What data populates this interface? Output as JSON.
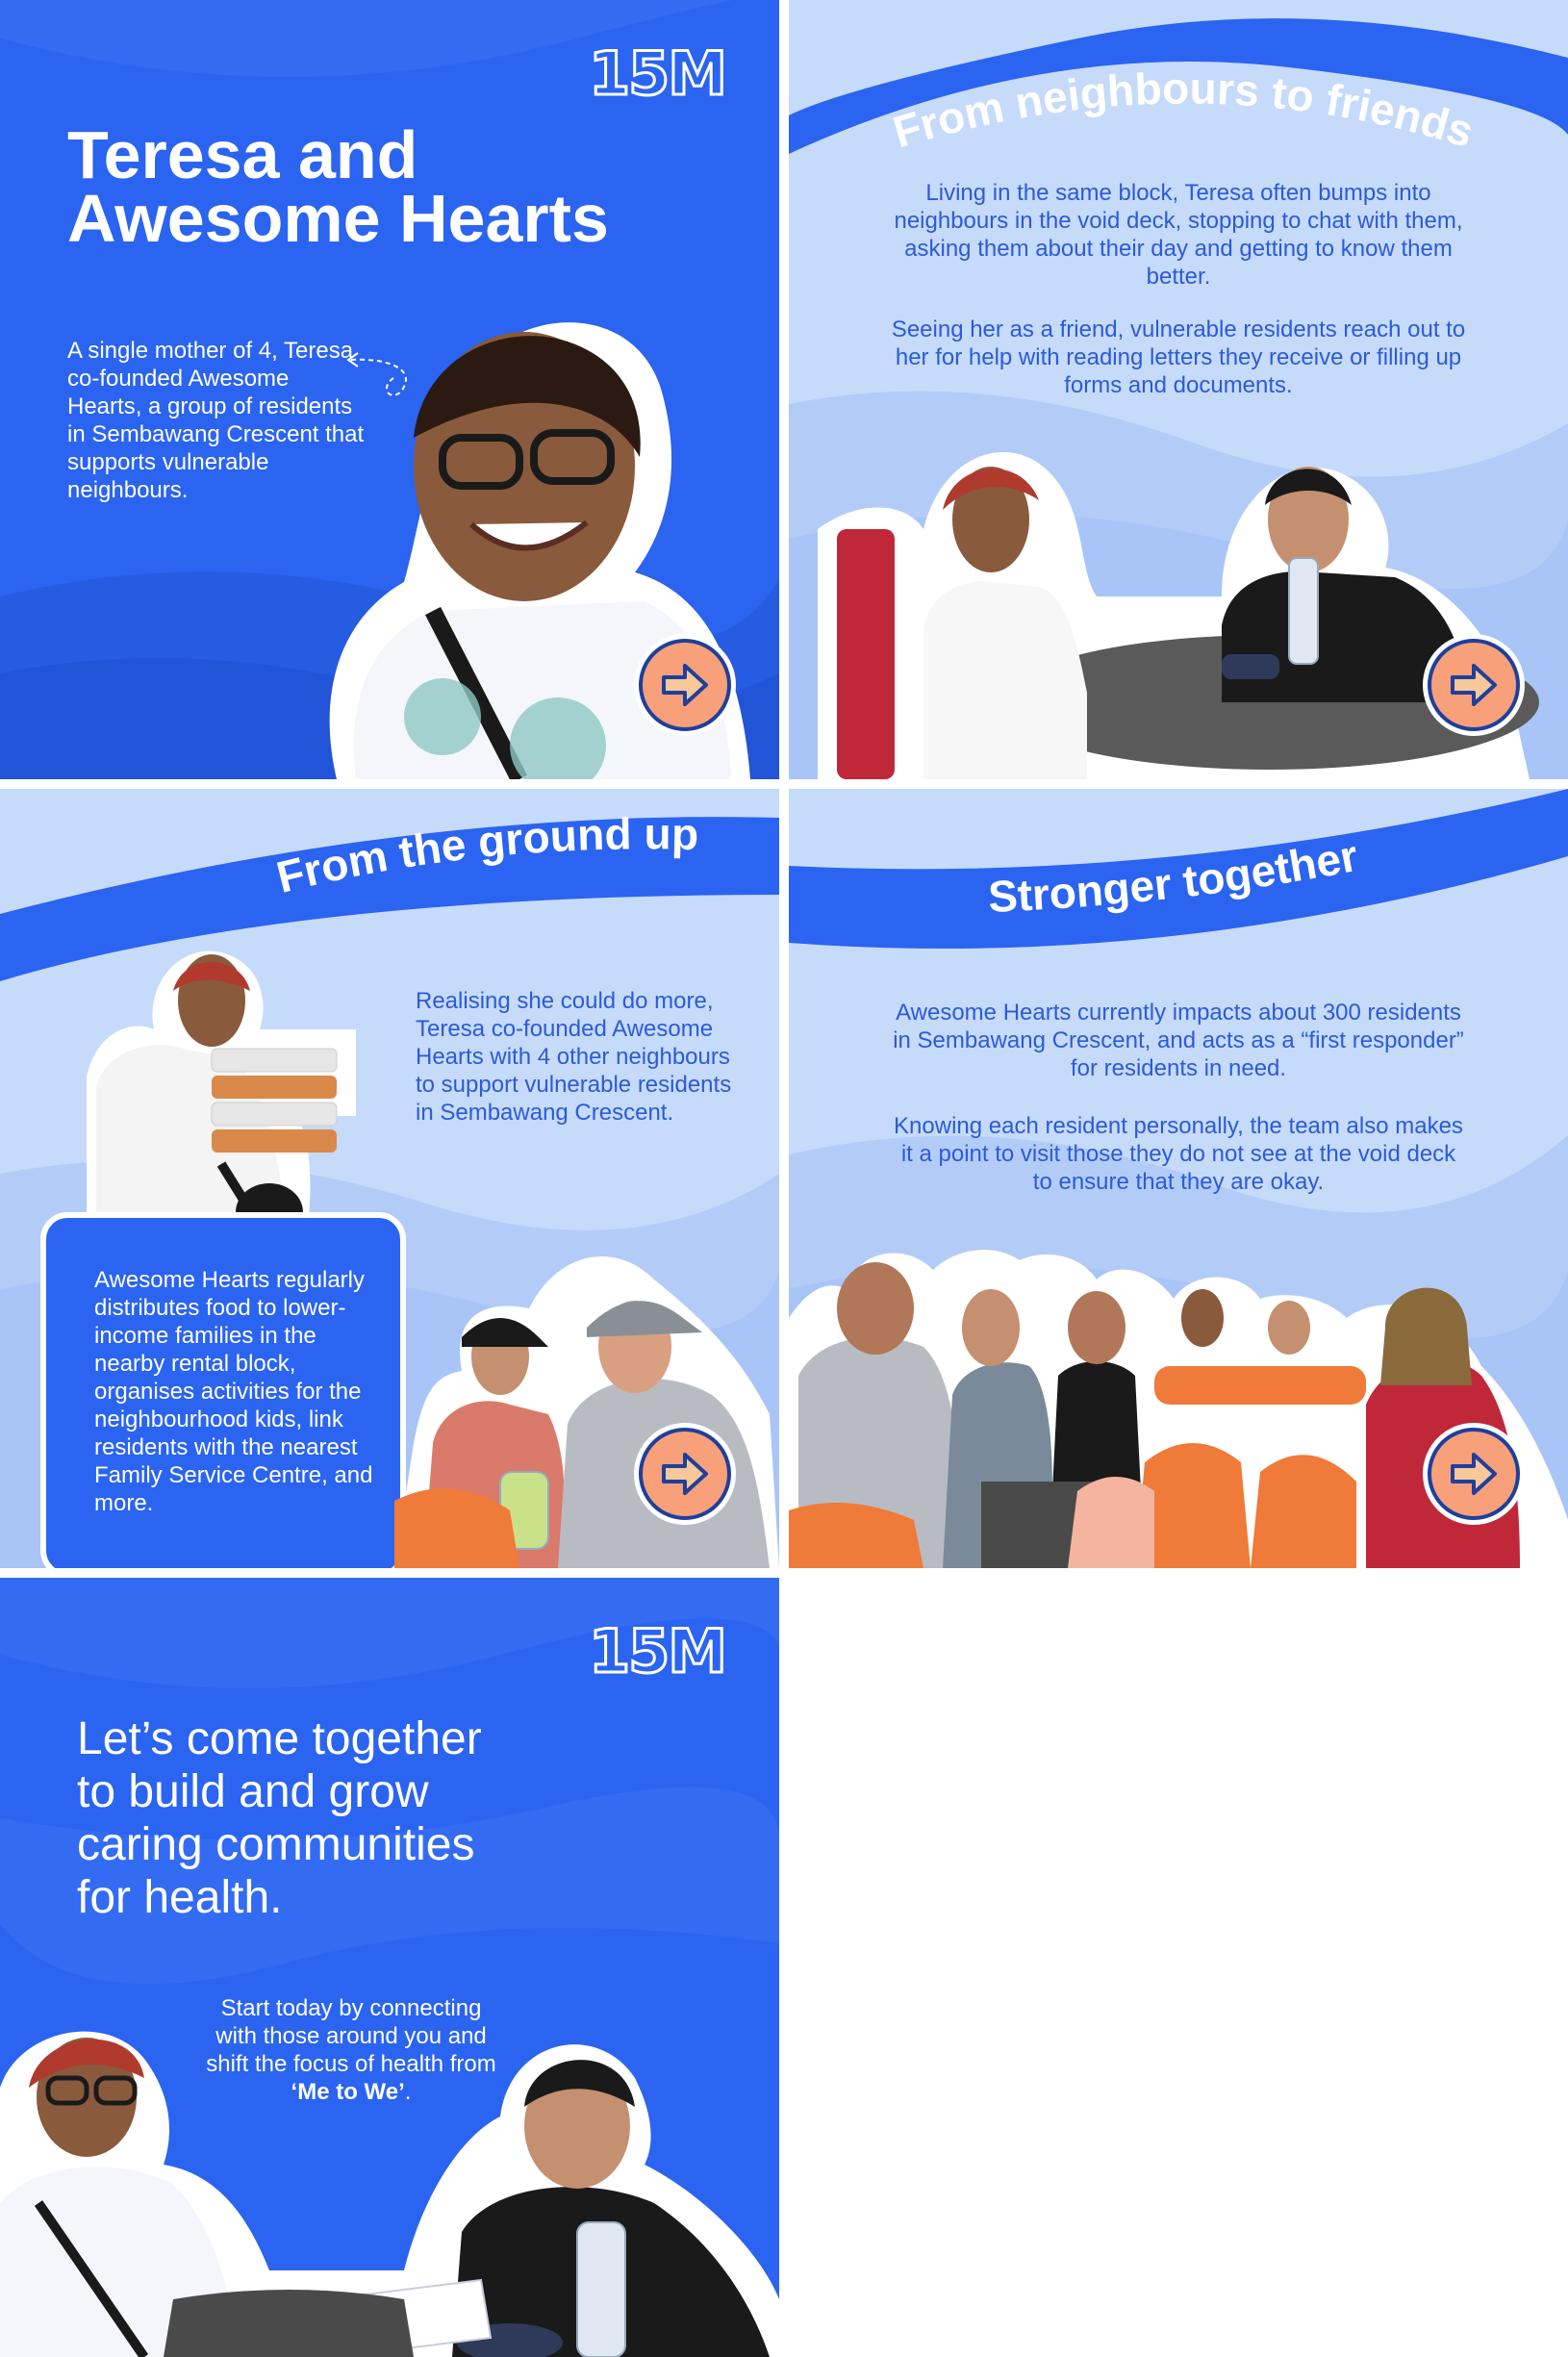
{
  "brand": {
    "logo_text": "15M",
    "primary_blue": "#2a64f0",
    "light_blue": "#c6dafa",
    "accent_orange": "#f7a07a",
    "text_blue": "#2b5bd9"
  },
  "slide1": {
    "title_line1": "Teresa and",
    "title_line2": "Awesome Hearts",
    "body": "A single mother of 4, Teresa co-founded Awesome Hearts, a group of residents in Sembawang Crescent that supports vulnerable neighbours.",
    "next_icon": "arrow-right-icon"
  },
  "slide2": {
    "heading": "From neighbours to friends",
    "para1": "Living in the same block, Teresa often bumps into neighbours in the void deck, stopping to chat with them, asking them about their day and getting to know them better.",
    "para2": "Seeing her as a friend, vulnerable residents reach out to her for help with reading letters they receive or filling up forms and documents.",
    "next_icon": "arrow-right-icon"
  },
  "slide3": {
    "heading": "From the ground up",
    "para1": "Realising she could do more, Teresa co-founded Awesome Hearts with 4 other neighbours to support vulnerable residents in Sembawang Crescent.",
    "box_text": "Awesome Hearts regularly distributes food to lower-income families in the nearby rental block, organises activities for the neighbourhood kids, link residents with the nearest Family Service Centre, and more.",
    "next_icon": "arrow-right-icon"
  },
  "slide4": {
    "heading": "Stronger together",
    "para1": "Awesome Hearts currently impacts about 300 residents in Sembawang Crescent, and acts as a “first responder” for residents in need.",
    "para2": "Knowing each resident personally, the team also makes it a point to visit those they do not see at the void deck to ensure that they are okay.",
    "next_icon": "arrow-right-icon"
  },
  "slide5": {
    "logo_text": "15M",
    "headline_line1": "Let’s come together",
    "headline_line2": "to build and grow",
    "headline_line3": "caring communities",
    "headline_line4": "for health.",
    "cta_prefix": "Start today by connecting with those around you and shift the focus of health from ",
    "cta_bold": "‘Me to We’",
    "cta_suffix": "."
  }
}
